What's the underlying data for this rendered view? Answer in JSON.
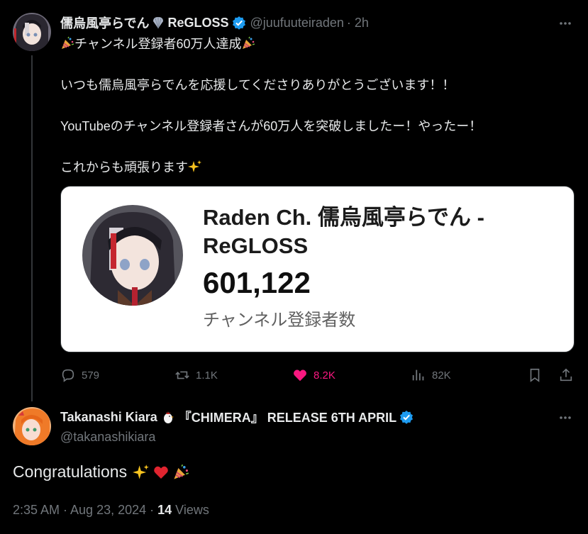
{
  "colors": {
    "background": "#000000",
    "text": "#e7e9ea",
    "muted": "#71767b",
    "verified": "#1d9bf0",
    "like": "#f91880"
  },
  "original": {
    "display_name": "儒烏風亭らでん",
    "display_name_suffix": "ReGLOSS",
    "name_emoji": "seashell-icon",
    "handle": "@juufuuteiraden",
    "time": "· 2h",
    "lines": [
      {
        "prefix_emoji": "party-popper-icon",
        "text": "チャンネル登録者60万人達成",
        "suffix_emoji": "party-popper-icon"
      },
      {
        "text": "いつも儒烏風亭らでんを応援してくださりありがとうございます！！"
      },
      {
        "text": "YouTubeのチャンネル登録者さんが60万人を突破しましたー！やったー！"
      },
      {
        "text": "これからも頑張ります",
        "suffix_emoji": "sparkles-icon"
      }
    ],
    "card": {
      "channel_name": "Raden Ch. 儒烏風亭らでん - ReGLOSS",
      "subscriber_count": "601,122",
      "subscriber_label": "チャンネル登録者数"
    },
    "actions": {
      "replies": "579",
      "reposts": "1.1K",
      "likes": "8.2K",
      "views": "82K"
    }
  },
  "reply": {
    "display_name": "Takanashi Kiara",
    "name_emoji": "chicken-icon",
    "name_rest": "『CHIMERA』 RELEASE 6TH APRIL",
    "handle": "@takanashikiara",
    "text": "Congratulations",
    "emojis": [
      "sparkles-icon",
      "red-heart-icon",
      "party-popper-icon"
    ],
    "timestamp": "2:35 AM · Aug 23, 2024 · ",
    "views_count": "14",
    "views_label": " Views"
  }
}
